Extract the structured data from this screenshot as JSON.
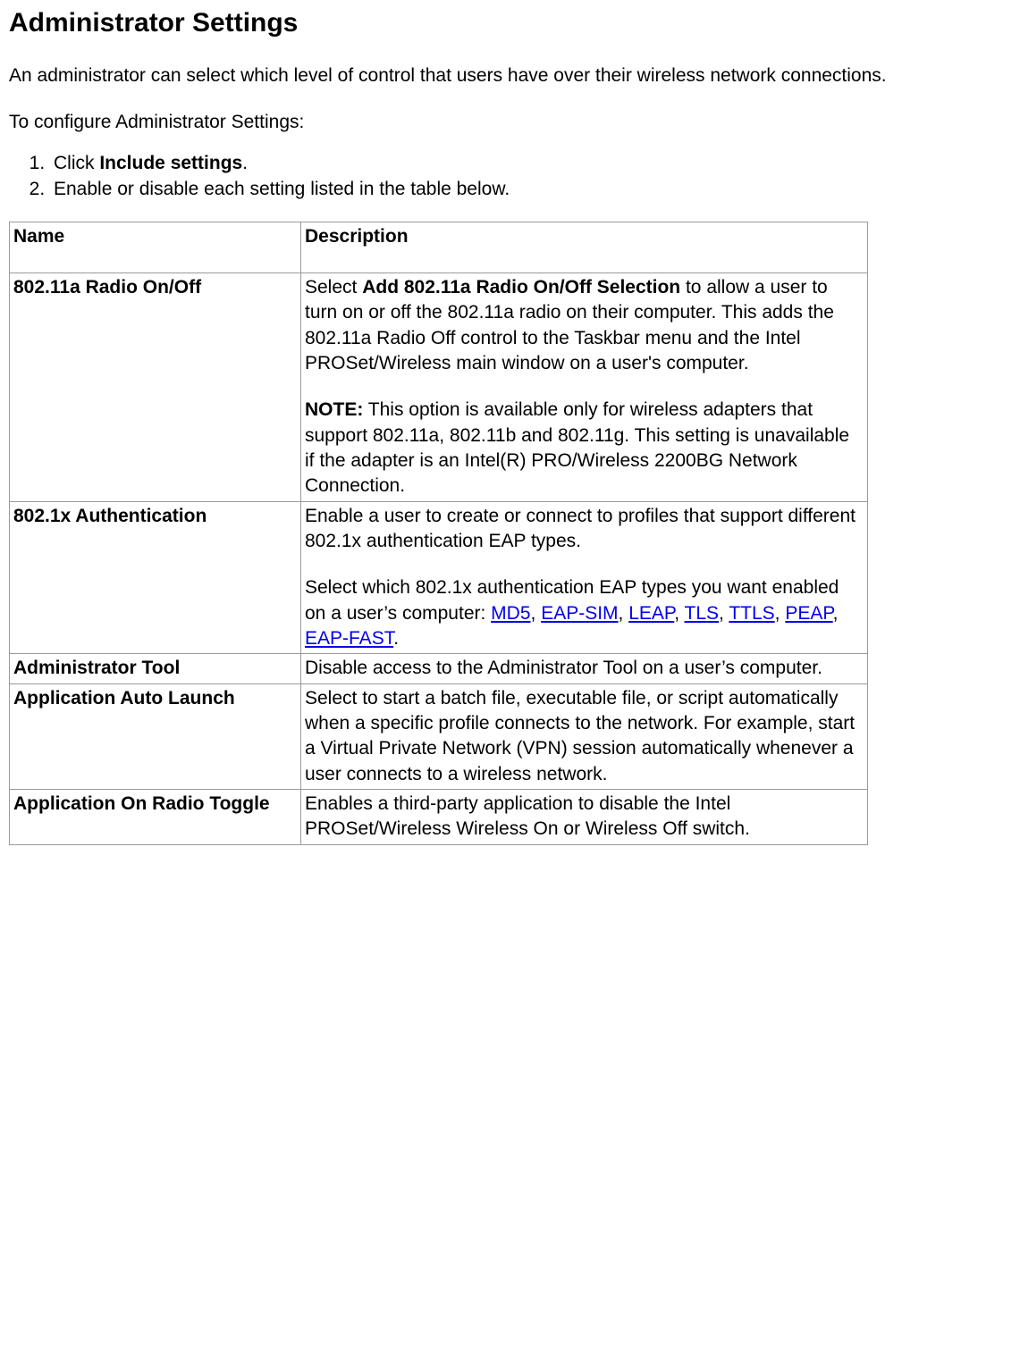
{
  "title": "Administrator Settings",
  "intro": "An administrator can select which level of control that users have over their wireless network connections.",
  "lead": "To configure Administrator Settings:",
  "steps": {
    "s1_prefix": "Click ",
    "s1_bold": "Include settings",
    "s1_suffix": ".",
    "s2": "Enable or disable each setting listed in the table below."
  },
  "headers": {
    "name": "Name",
    "description": "Description"
  },
  "rows": {
    "r1_name": "802.11a Radio On/Off",
    "r1_p1_a": "Select ",
    "r1_p1_bold": "Add 802.11a Radio On/Off Selection",
    "r1_p1_b": " to allow a user to turn on or off the 802.11a radio on their computer. This adds the 802.11a Radio Off control to the Taskbar menu and the Intel PROSet/Wireless main window on a user's computer.",
    "r1_p2_bold": "NOTE:",
    "r1_p2_rest": " This option is available only for wireless adapters that support 802.11a, 802.11b and 802.11g. This setting is unavailable if the adapter is an Intel(R) PRO/Wireless 2200BG Network Connection.",
    "r2_name": "802.1x Authentication",
    "r2_p1": "Enable a user to create or connect to profiles that support different 802.1x authentication EAP types.",
    "r2_p2_a": "Select which 802.1x authentication EAP types you want enabled on a user’s computer: ",
    "r2_links": {
      "md5": "MD5",
      "eapsim": "EAP-SIM",
      "leap": "LEAP",
      "tls": "TLS",
      "ttls": "TTLS",
      "peap": "PEAP",
      "eapfast": "EAP-FAST"
    },
    "r2_sep": ", ",
    "r2_end": ".",
    "r3_name": "Administrator Tool",
    "r3_desc": "Disable access to the Administrator Tool on a user’s computer.",
    "r4_name": "Application Auto Launch",
    "r4_desc": "Select to start a batch file, executable file, or script automatically when a specific profile connects to the network. For example, start a Virtual Private Network (VPN) session automatically whenever a user connects to a wireless network.",
    "r5_name": "Application On Radio Toggle",
    "r5_desc": "Enables a third-party application to disable the Intel PROSet/Wireless Wireless On or Wireless Off switch."
  }
}
